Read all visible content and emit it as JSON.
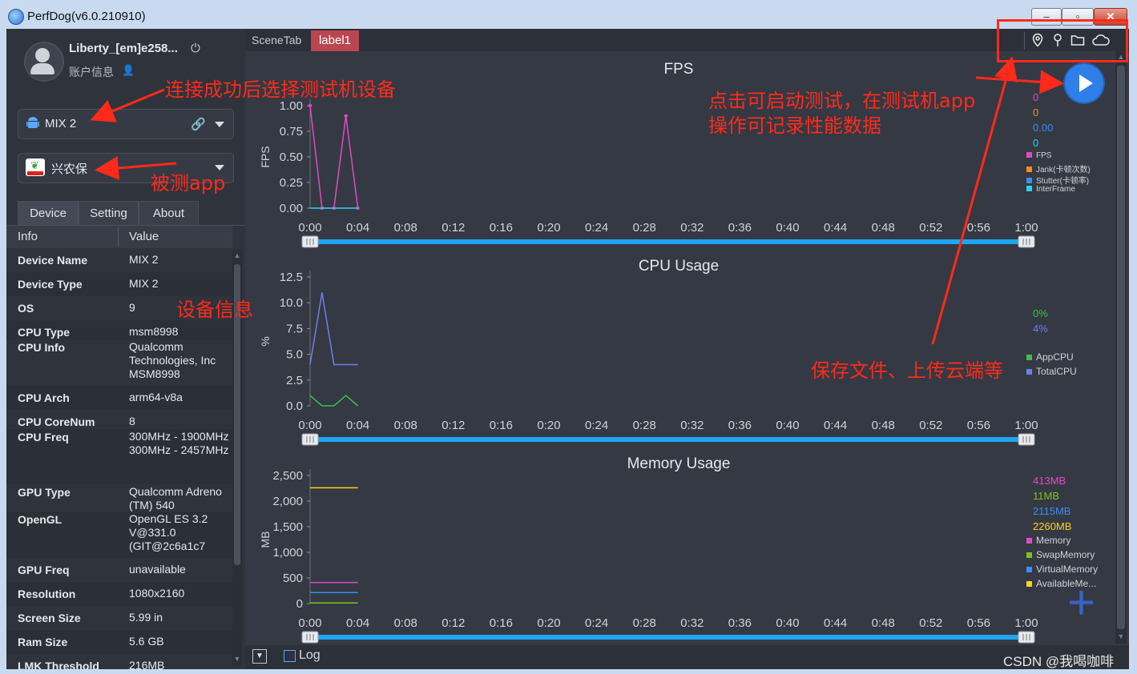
{
  "window": {
    "title": "PerfDog(v6.0.210910)",
    "controls": [
      "–",
      "▫",
      "✕"
    ]
  },
  "sidebar": {
    "user_name": "Liberty_[em]e258...",
    "account_info": "账户信息",
    "device_selected": "MIX 2",
    "app_selected": "兴农保",
    "tabs": [
      "Device",
      "Setting",
      "About"
    ],
    "table_headers": {
      "info": "Info",
      "value": "Value"
    },
    "rows": [
      {
        "label": "Device Name",
        "value": "MIX 2"
      },
      {
        "label": "Device Type",
        "value": "MIX 2"
      },
      {
        "label": "OS",
        "value": "9"
      },
      {
        "label": "CPU Type",
        "value": "msm8998"
      },
      {
        "label": "CPU Info",
        "value": "Qualcomm Technologies, Inc MSM8998"
      },
      {
        "label": "CPU Arch",
        "value": "arm64-v8a"
      },
      {
        "label": "CPU CoreNum",
        "value": "8"
      },
      {
        "label": "CPU Freq",
        "value": "300MHz - 1900MHz 300MHz - 2457MHz"
      },
      {
        "label": "GPU Type",
        "value": "Qualcomm Adreno (TM) 540"
      },
      {
        "label": "OpenGL",
        "value": "OpenGL ES 3.2 V@331.0 (GIT@2c6a1c7"
      },
      {
        "label": "GPU Freq",
        "value": "unavailable"
      },
      {
        "label": "Resolution",
        "value": "1080x2160"
      },
      {
        "label": "Screen Size",
        "value": "5.99 in"
      },
      {
        "label": "Ram Size",
        "value": "5.6 GB"
      },
      {
        "label": "LMK Threshold",
        "value": "216MB"
      }
    ]
  },
  "main": {
    "scene_tab": "SceneTab",
    "label_tab": "label1",
    "toolbar_icons": [
      "location-icon",
      "pin-icon",
      "folder-icon",
      "cloud-icon"
    ],
    "log_label": "Log"
  },
  "legends": {
    "fps": {
      "values": [
        {
          "text": "0",
          "color": "#e24ac4"
        },
        {
          "text": "0",
          "color": "#ff8a1c"
        },
        {
          "text": "0.00",
          "color": "#3a8ff0"
        },
        {
          "text": "0",
          "color": "#2ad2f0"
        }
      ],
      "items": [
        {
          "text": "FPS",
          "color": "#e24ac4"
        },
        {
          "text": "Jank(卡顿次数)",
          "color": "#ff8a1c"
        },
        {
          "text": "Stutter(卡顿率)",
          "color": "#3a8ff0"
        },
        {
          "text": "InterFrame",
          "color": "#2ad2f0"
        }
      ]
    },
    "cpu": {
      "values": [
        {
          "text": "0%",
          "color": "#39c04a"
        },
        {
          "text": "4%",
          "color": "#6f7ef0"
        }
      ],
      "items": [
        {
          "text": "AppCPU",
          "color": "#39c04a"
        },
        {
          "text": "TotalCPU",
          "color": "#6f7ef0"
        }
      ]
    },
    "memory": {
      "values": [
        {
          "text": "413MB",
          "color": "#e24ac4"
        },
        {
          "text": "11MB",
          "color": "#7ec21a"
        },
        {
          "text": "2115MB",
          "color": "#3a8ff0"
        },
        {
          "text": "2260MB",
          "color": "#ffd21c"
        }
      ],
      "items": [
        {
          "text": "Memory",
          "color": "#e24ac4"
        },
        {
          "text": "SwapMemory",
          "color": "#7ec21a"
        },
        {
          "text": "VirtualMemory",
          "color": "#3a8ff0"
        },
        {
          "text": "AvailableMe...",
          "color": "#ffd21c"
        }
      ]
    }
  },
  "chart_data": [
    {
      "type": "line",
      "title": "FPS",
      "ylabel": "FPS",
      "ylim": [
        0,
        1
      ],
      "yticks": [
        "0.00",
        "0.25",
        "0.50",
        "0.75",
        "1.00"
      ],
      "xticks": [
        "0:00",
        "0:04",
        "0:08",
        "0:12",
        "0:16",
        "0:20",
        "0:24",
        "0:28",
        "0:32",
        "0:36",
        "0:40",
        "0:44",
        "0:48",
        "0:52",
        "0:56",
        "1:00"
      ],
      "xlim_seconds": [
        0,
        60
      ],
      "series": [
        {
          "name": "FPS",
          "color": "#e24ac4",
          "x": [
            0,
            1,
            2,
            3,
            4
          ],
          "y": [
            1,
            0,
            0,
            0.9,
            0
          ]
        },
        {
          "name": "InterFrame",
          "color": "#2ad2f0",
          "x": [
            0,
            4
          ],
          "y": [
            0,
            0
          ]
        }
      ]
    },
    {
      "type": "line",
      "title": "CPU Usage",
      "ylabel": "%",
      "ylim": [
        0,
        12.5
      ],
      "yticks": [
        "0.0",
        "2.5",
        "5.0",
        "7.5",
        "10.0",
        "12.5"
      ],
      "xticks": [
        "0:00",
        "0:04",
        "0:08",
        "0:12",
        "0:16",
        "0:20",
        "0:24",
        "0:28",
        "0:32",
        "0:36",
        "0:40",
        "0:44",
        "0:48",
        "0:52",
        "0:56",
        "1:00"
      ],
      "xlim_seconds": [
        0,
        60
      ],
      "series": [
        {
          "name": "TotalCPU",
          "color": "#6f7ef0",
          "x": [
            0,
            1,
            2,
            3,
            4
          ],
          "y": [
            4,
            11,
            4,
            4,
            4
          ]
        },
        {
          "name": "AppCPU",
          "color": "#39c04a",
          "x": [
            0,
            1,
            2,
            3,
            4
          ],
          "y": [
            1,
            0,
            0,
            1,
            0
          ]
        }
      ]
    },
    {
      "type": "line",
      "title": "Memory Usage",
      "ylabel": "MB",
      "ylim": [
        0,
        2500
      ],
      "yticks": [
        "0",
        "500",
        "1,000",
        "1,500",
        "2,000",
        "2,500"
      ],
      "xticks": [
        "0:00",
        "0:04",
        "0:08",
        "0:12",
        "0:16",
        "0:20",
        "0:24",
        "0:28",
        "0:32",
        "0:36",
        "0:40",
        "0:44",
        "0:48",
        "0:52",
        "0:56",
        "1:00"
      ],
      "xlim_seconds": [
        0,
        60
      ],
      "series": [
        {
          "name": "AvailableMemory",
          "color": "#ffd21c",
          "x": [
            0,
            4
          ],
          "y": [
            2260,
            2260
          ]
        },
        {
          "name": "Memory",
          "color": "#e24ac4",
          "x": [
            0,
            4
          ],
          "y": [
            413,
            413
          ]
        },
        {
          "name": "VirtualMemory",
          "color": "#3a8ff0",
          "x": [
            0,
            4
          ],
          "y": [
            215,
            215
          ]
        },
        {
          "name": "SwapMemory",
          "color": "#7ec21a",
          "x": [
            0,
            4
          ],
          "y": [
            11,
            11
          ]
        }
      ]
    }
  ],
  "annotations": {
    "select_device": "连接成功后选择测试机设备",
    "tested_app": "被测app",
    "device_info": "设备信息",
    "start_test_line1": "点击可启动测试，在测试机app",
    "start_test_line2": "操作可记录性能数据",
    "save_upload": "保存文件、上传云端等"
  },
  "watermark": "CSDN @我喝咖啡"
}
